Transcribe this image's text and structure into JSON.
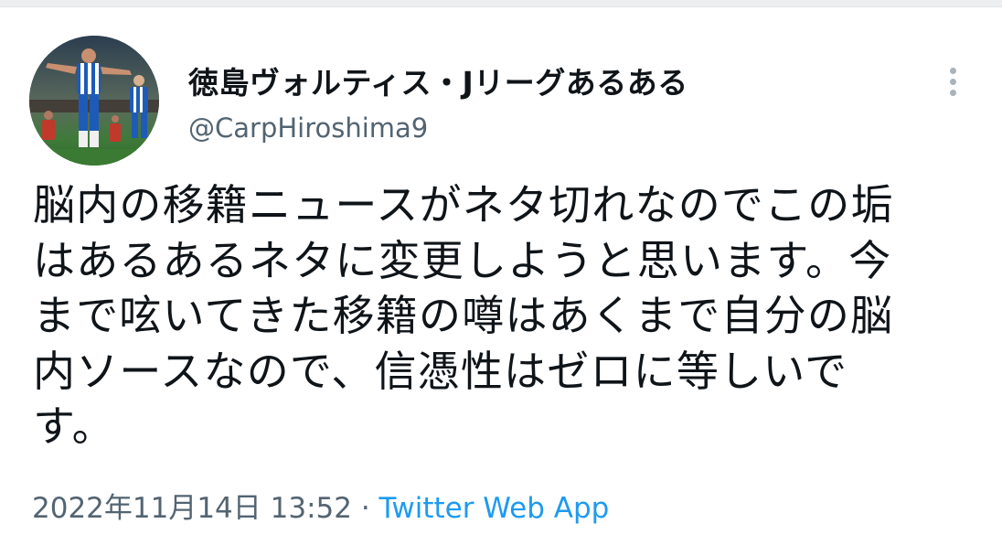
{
  "tweet": {
    "author": {
      "display_name": "徳島ヴォルティス・Jリーグあるある",
      "handle": "@CarpHiroshima9"
    },
    "text_lines": [
      "脳内の移籍ニュースがネタ切れなのでこの垢",
      "はあるあるネタに変更しようと思います。今",
      "まで呟いてきた移籍の噂はあくまで自分の脳",
      "内ソースなので、信憑性はゼロに等しいで",
      "す。"
    ],
    "timestamp": "2022年11月14日 13:52",
    "separator": " · ",
    "source": "Twitter Web App"
  },
  "icons": {
    "more": "more-vertical-icon"
  },
  "colors": {
    "text_primary": "#0f1419",
    "text_secondary": "#536471",
    "link": "#1d9bf0"
  }
}
